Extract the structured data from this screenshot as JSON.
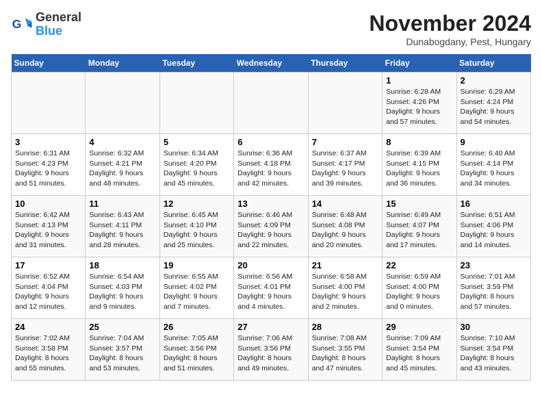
{
  "logo": {
    "line1": "General",
    "line2": "Blue"
  },
  "title": "November 2024",
  "subtitle": "Dunabogdany, Pest, Hungary",
  "weekdays": [
    "Sunday",
    "Monday",
    "Tuesday",
    "Wednesday",
    "Thursday",
    "Friday",
    "Saturday"
  ],
  "weeks": [
    [
      {
        "day": "",
        "info": ""
      },
      {
        "day": "",
        "info": ""
      },
      {
        "day": "",
        "info": ""
      },
      {
        "day": "",
        "info": ""
      },
      {
        "day": "",
        "info": ""
      },
      {
        "day": "1",
        "info": "Sunrise: 6:28 AM\nSunset: 4:26 PM\nDaylight: 9 hours\nand 57 minutes."
      },
      {
        "day": "2",
        "info": "Sunrise: 6:29 AM\nSunset: 4:24 PM\nDaylight: 9 hours\nand 54 minutes."
      }
    ],
    [
      {
        "day": "3",
        "info": "Sunrise: 6:31 AM\nSunset: 4:23 PM\nDaylight: 9 hours\nand 51 minutes."
      },
      {
        "day": "4",
        "info": "Sunrise: 6:32 AM\nSunset: 4:21 PM\nDaylight: 9 hours\nand 48 minutes."
      },
      {
        "day": "5",
        "info": "Sunrise: 6:34 AM\nSunset: 4:20 PM\nDaylight: 9 hours\nand 45 minutes."
      },
      {
        "day": "6",
        "info": "Sunrise: 6:36 AM\nSunset: 4:18 PM\nDaylight: 9 hours\nand 42 minutes."
      },
      {
        "day": "7",
        "info": "Sunrise: 6:37 AM\nSunset: 4:17 PM\nDaylight: 9 hours\nand 39 minutes."
      },
      {
        "day": "8",
        "info": "Sunrise: 6:39 AM\nSunset: 4:15 PM\nDaylight: 9 hours\nand 36 minutes."
      },
      {
        "day": "9",
        "info": "Sunrise: 6:40 AM\nSunset: 4:14 PM\nDaylight: 9 hours\nand 34 minutes."
      }
    ],
    [
      {
        "day": "10",
        "info": "Sunrise: 6:42 AM\nSunset: 4:13 PM\nDaylight: 9 hours\nand 31 minutes."
      },
      {
        "day": "11",
        "info": "Sunrise: 6:43 AM\nSunset: 4:11 PM\nDaylight: 9 hours\nand 28 minutes."
      },
      {
        "day": "12",
        "info": "Sunrise: 6:45 AM\nSunset: 4:10 PM\nDaylight: 9 hours\nand 25 minutes."
      },
      {
        "day": "13",
        "info": "Sunrise: 6:46 AM\nSunset: 4:09 PM\nDaylight: 9 hours\nand 22 minutes."
      },
      {
        "day": "14",
        "info": "Sunrise: 6:48 AM\nSunset: 4:08 PM\nDaylight: 9 hours\nand 20 minutes."
      },
      {
        "day": "15",
        "info": "Sunrise: 6:49 AM\nSunset: 4:07 PM\nDaylight: 9 hours\nand 17 minutes."
      },
      {
        "day": "16",
        "info": "Sunrise: 6:51 AM\nSunset: 4:06 PM\nDaylight: 9 hours\nand 14 minutes."
      }
    ],
    [
      {
        "day": "17",
        "info": "Sunrise: 6:52 AM\nSunset: 4:04 PM\nDaylight: 9 hours\nand 12 minutes."
      },
      {
        "day": "18",
        "info": "Sunrise: 6:54 AM\nSunset: 4:03 PM\nDaylight: 9 hours\nand 9 minutes."
      },
      {
        "day": "19",
        "info": "Sunrise: 6:55 AM\nSunset: 4:02 PM\nDaylight: 9 hours\nand 7 minutes."
      },
      {
        "day": "20",
        "info": "Sunrise: 6:56 AM\nSunset: 4:01 PM\nDaylight: 9 hours\nand 4 minutes."
      },
      {
        "day": "21",
        "info": "Sunrise: 6:58 AM\nSunset: 4:00 PM\nDaylight: 9 hours\nand 2 minutes."
      },
      {
        "day": "22",
        "info": "Sunrise: 6:59 AM\nSunset: 4:00 PM\nDaylight: 9 hours\nand 0 minutes."
      },
      {
        "day": "23",
        "info": "Sunrise: 7:01 AM\nSunset: 3:59 PM\nDaylight: 8 hours\nand 57 minutes."
      }
    ],
    [
      {
        "day": "24",
        "info": "Sunrise: 7:02 AM\nSunset: 3:58 PM\nDaylight: 8 hours\nand 55 minutes."
      },
      {
        "day": "25",
        "info": "Sunrise: 7:04 AM\nSunset: 3:57 PM\nDaylight: 8 hours\nand 53 minutes."
      },
      {
        "day": "26",
        "info": "Sunrise: 7:05 AM\nSunset: 3:56 PM\nDaylight: 8 hours\nand 51 minutes."
      },
      {
        "day": "27",
        "info": "Sunrise: 7:06 AM\nSunset: 3:56 PM\nDaylight: 8 hours\nand 49 minutes."
      },
      {
        "day": "28",
        "info": "Sunrise: 7:08 AM\nSunset: 3:55 PM\nDaylight: 8 hours\nand 47 minutes."
      },
      {
        "day": "29",
        "info": "Sunrise: 7:09 AM\nSunset: 3:54 PM\nDaylight: 8 hours\nand 45 minutes."
      },
      {
        "day": "30",
        "info": "Sunrise: 7:10 AM\nSunset: 3:54 PM\nDaylight: 8 hours\nand 43 minutes."
      }
    ]
  ]
}
